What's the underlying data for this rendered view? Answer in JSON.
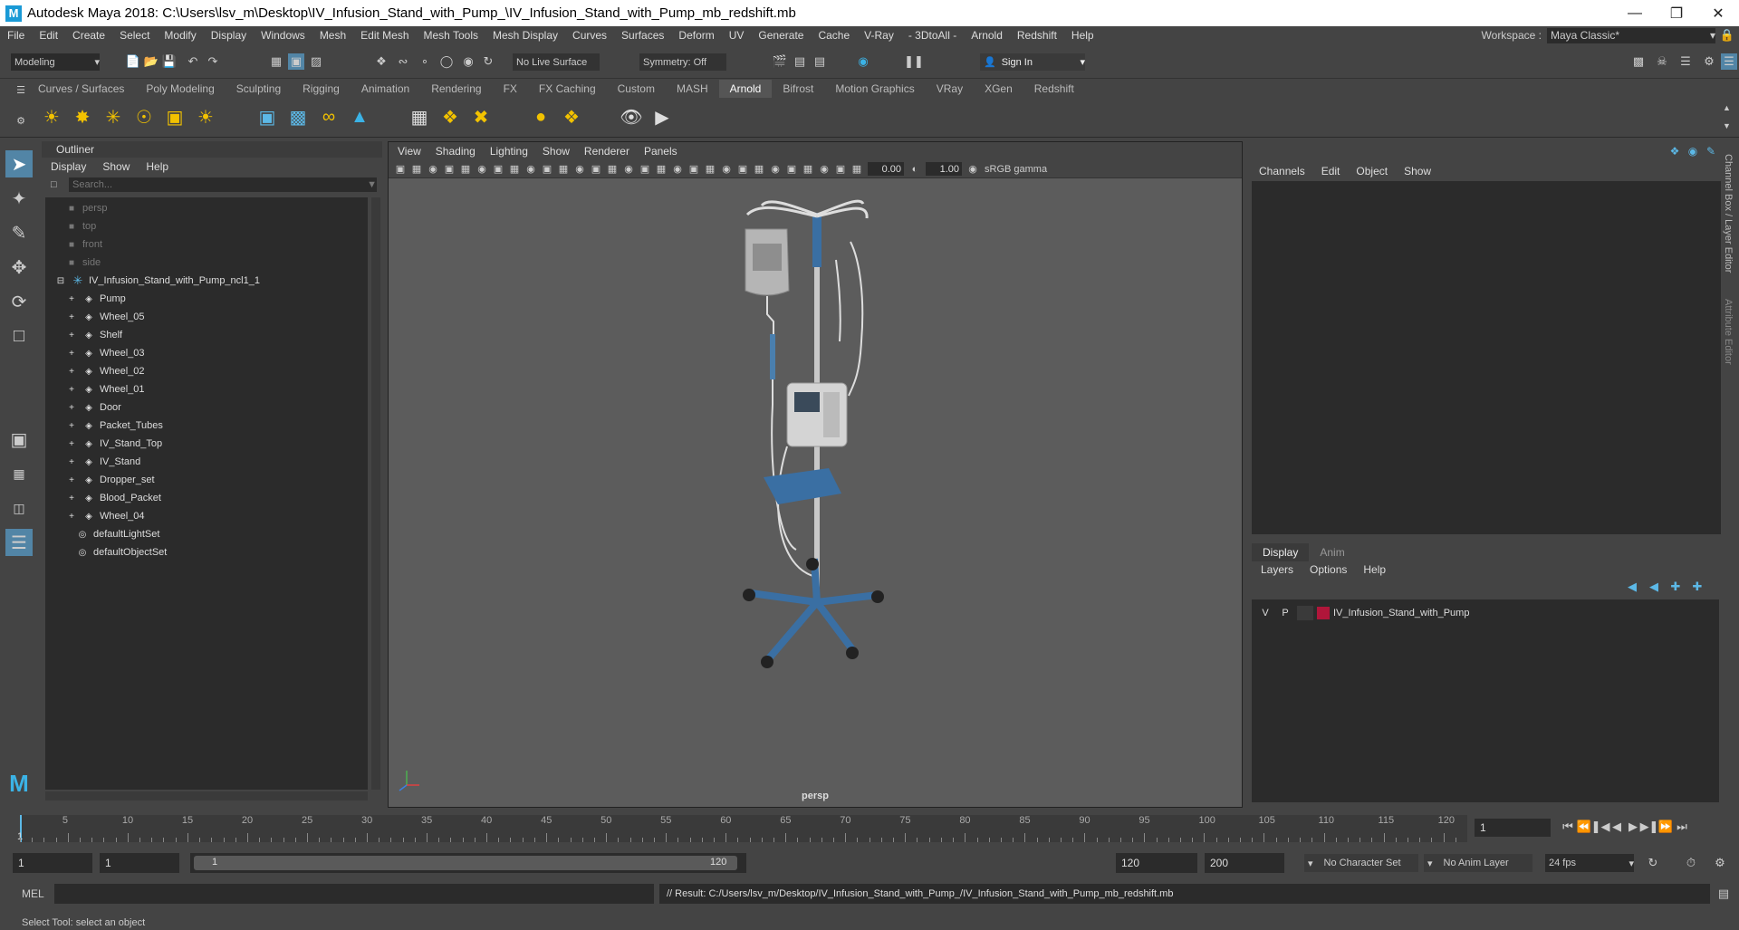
{
  "window": {
    "title": "Autodesk Maya 2018: C:\\Users\\lsv_m\\Desktop\\IV_Infusion_Stand_with_Pump_\\IV_Infusion_Stand_with_Pump_mb_redshift.mb",
    "logo": "M"
  },
  "menubar": [
    "File",
    "Edit",
    "Create",
    "Select",
    "Modify",
    "Display",
    "Windows",
    "Mesh",
    "Edit Mesh",
    "Mesh Tools",
    "Mesh Display",
    "Curves",
    "Surfaces",
    "Deform",
    "UV",
    "Generate",
    "Cache",
    "V-Ray",
    "- 3DtoAll -",
    "Arnold",
    "Redshift",
    "Help"
  ],
  "workspace": {
    "label": "Workspace :",
    "value": "Maya Classic*"
  },
  "statusline": {
    "mode": "Modeling",
    "live_surface": "No Live Surface",
    "symmetry": "Symmetry: Off",
    "sign_in": "Sign In"
  },
  "shelf_tabs": [
    "Curves / Surfaces",
    "Poly Modeling",
    "Sculpting",
    "Rigging",
    "Animation",
    "Rendering",
    "FX",
    "FX Caching",
    "Custom",
    "MASH",
    "Arnold",
    "Bifrost",
    "Motion Graphics",
    "VRay",
    "XGen",
    "Redshift"
  ],
  "active_shelf_tab": "Arnold",
  "outliner": {
    "title": "Outliner",
    "menu": [
      "Display",
      "Show",
      "Help"
    ],
    "search_placeholder": "Search...",
    "cameras": [
      "persp",
      "top",
      "front",
      "side"
    ],
    "root": "IV_Infusion_Stand_with_Pump_ncl1_1",
    "children": [
      "Pump",
      "Wheel_05",
      "Shelf",
      "Wheel_03",
      "Wheel_02",
      "Wheel_01",
      "Door",
      "Packet_Tubes",
      "IV_Stand_Top",
      "IV_Stand",
      "Dropper_set",
      "Blood_Packet",
      "Wheel_04"
    ],
    "sets": [
      "defaultLightSet",
      "defaultObjectSet"
    ]
  },
  "viewport": {
    "menu": [
      "View",
      "Shading",
      "Lighting",
      "Show",
      "Renderer",
      "Panels"
    ],
    "exposure": "0.00",
    "gamma": "1.00",
    "color_space": "sRGB gamma",
    "camera": "persp"
  },
  "channelbox": {
    "menu": [
      "Channels",
      "Edit",
      "Object",
      "Show"
    ]
  },
  "side_tabs": [
    "Channel Box / Layer Editor",
    "Attribute Editor"
  ],
  "layer_editor": {
    "tabs": [
      "Display",
      "Anim"
    ],
    "menu": [
      "Layers",
      "Options",
      "Help"
    ],
    "layer": {
      "v": "V",
      "p": "P",
      "color": "#b0163a",
      "name": "IV_Infusion_Stand_with_Pump"
    }
  },
  "timeline": {
    "ticks": [
      "5",
      "10",
      "15",
      "20",
      "25",
      "30",
      "35",
      "40",
      "45",
      "50",
      "55",
      "60",
      "65",
      "70",
      "75",
      "80",
      "85",
      "90",
      "95",
      "100",
      "105",
      "110",
      "115",
      "120"
    ],
    "current_frame_marker": "1",
    "current_frame": "1"
  },
  "range": {
    "start": "1",
    "anim_start": "1",
    "slider_start": "1",
    "slider_end": "120",
    "end": "120",
    "anim_end": "200",
    "character_set": "No Character Set",
    "anim_layer": "No Anim Layer",
    "fps": "24 fps"
  },
  "command": {
    "label": "MEL",
    "result": "// Result: C:/Users/lsv_m/Desktop/IV_Infusion_Stand_with_Pump_/IV_Infusion_Stand_with_Pump_mb_redshift.mb"
  },
  "help_line": "Select Tool: select an object"
}
